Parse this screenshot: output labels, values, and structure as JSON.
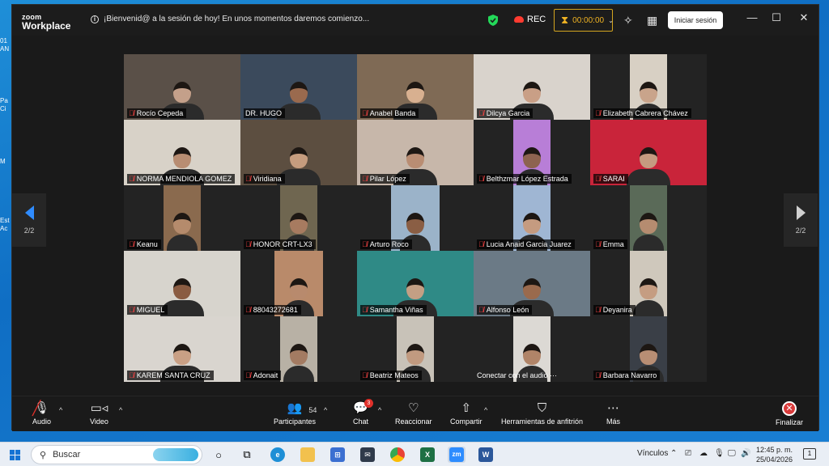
{
  "window": {
    "logo_line1": "zoom",
    "logo_line2": "Workplace",
    "notice": "¡Bienvenid@ a la sesión de hoy! En unos momentos daremos comienzo...",
    "rec_label": "REC",
    "timer": "00:00:00",
    "signin": "Iniciar sesión"
  },
  "stage": {
    "page_left": "2/2",
    "page_right": "2/2",
    "participants": [
      {
        "name": "Rocío Cepeda",
        "bg": "#5a5048",
        "skin": "#c4a08a",
        "muted": true
      },
      {
        "name": "DR. HUGO",
        "bg": "#3b4a5c",
        "skin": "#9a6a4e",
        "muted": false,
        "active": true
      },
      {
        "name": "Anabel Banda",
        "bg": "#7f6a55",
        "skin": "#d8b090",
        "muted": true
      },
      {
        "name": "Dilcya Garcia",
        "bg": "#d9d3cc",
        "skin": "#c99f86",
        "muted": true
      },
      {
        "name": "Elizabeth Cabrera Chávez",
        "bg": "#d8d0c4",
        "skin": "#c9a48b",
        "muted": true
      },
      {
        "name": "NORMA MENDIOLA GOMEZ",
        "bg": "#d8d2c8",
        "skin": "#b88d72",
        "muted": true
      },
      {
        "name": "Viridiana",
        "bg": "#5c4e40",
        "skin": "#c59c7e",
        "muted": true
      },
      {
        "name": "Pilar López",
        "bg": "#c7b7aa",
        "skin": "#b98d73",
        "muted": true
      },
      {
        "name": "Belthzmar López Estrada",
        "bg": "#b87ed7",
        "skin": "#8d6350",
        "muted": true
      },
      {
        "name": "SARAI",
        "bg": "#c9243a",
        "skin": "#c59b80",
        "muted": true
      },
      {
        "name": "Keanu",
        "bg": "#8a6a4e",
        "skin": "#b58b6c",
        "muted": true
      },
      {
        "name": "HONOR CRT-LX3",
        "bg": "#6f6650",
        "skin": "#a77b60",
        "muted": true
      },
      {
        "name": "Arturo Roco",
        "bg": "#9bb3c9",
        "skin": "#8a5e44",
        "muted": true
      },
      {
        "name": "Lucia Anaid Garcia Juarez",
        "bg": "#9fb6d3",
        "skin": "#c59b80",
        "muted": true
      },
      {
        "name": "Emma",
        "bg": "#5a6a58",
        "skin": "#b58c70",
        "muted": true
      },
      {
        "name": "MIGUEL",
        "bg": "#d7d4cd",
        "skin": "#8a5c42",
        "muted": true
      },
      {
        "name": "88043272681",
        "bg": "#b98a6a",
        "skin": "#b88a6d",
        "muted": true
      },
      {
        "name": "Samantha Viñas",
        "bg": "#2f8a86",
        "skin": "#c49f84",
        "muted": true
      },
      {
        "name": "Alfonso León",
        "bg": "#6b7a86",
        "skin": "#9a6a4d",
        "muted": true
      },
      {
        "name": "Deyanira",
        "bg": "#cfc8bc",
        "skin": "#c59d82",
        "muted": true
      },
      {
        "name": "KAREM SANTA CRUZ",
        "bg": "#d9d5cf",
        "skin": "#c9a085",
        "muted": true
      },
      {
        "name": "Adonait",
        "bg": "#b8b1a5",
        "skin": "#a37b62",
        "muted": true
      },
      {
        "name": "Beatriz Mateos",
        "bg": "#c8c2b8",
        "skin": "#c19a80",
        "muted": true
      },
      {
        "name": "Conectar con el audio ···",
        "bg": "#dcd9d4",
        "skin": "#b08468",
        "muted": false,
        "connect": true
      },
      {
        "name": "Barbara Navarro",
        "bg": "#3a3f47",
        "skin": "#b88e74",
        "muted": true
      }
    ]
  },
  "toolbar": {
    "audio": "Audio",
    "video": "Video",
    "participants": "Participantes",
    "participants_count": "54",
    "chat": "Chat",
    "chat_badge": "3",
    "react": "Reaccionar",
    "share": "Compartir",
    "host_tools": "Herramientas de anfitrión",
    "more": "Más",
    "end": "Finalizar"
  },
  "taskbar": {
    "search_placeholder": "Buscar",
    "vinculos": "Vínculos",
    "time": "12:45 p. m.",
    "date": "25/04/2026",
    "notif_count": "1"
  },
  "desktop_peek": [
    "01",
    "AN",
    "Pa",
    "Ci",
    "M",
    "Est",
    "Ac"
  ]
}
